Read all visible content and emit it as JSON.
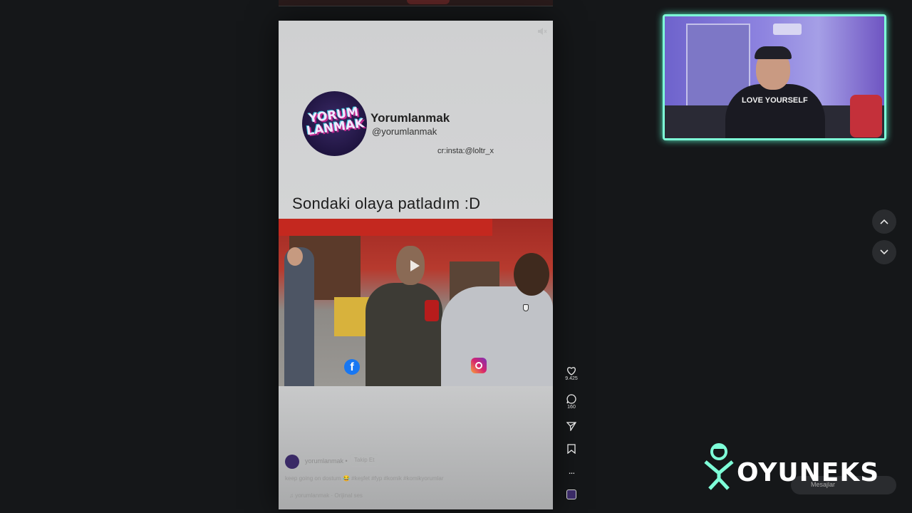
{
  "channel": {
    "name": "Yorumlanmak",
    "handle": "@yorumlanmak",
    "logo_text_line1": "YORUM",
    "logo_text_line2": "LANMAK",
    "credit": "cr:insta:@loltr_x"
  },
  "reel": {
    "caption_title": "Sondaki olaya patladım :D"
  },
  "post": {
    "username": "yorumlanmak",
    "separator": "•",
    "follow_label": "Takip Et",
    "caption": "keep going on dostum 😂 #keşfet #fyp #komik #komikyorumlar",
    "audio": "yorumlanmak · Orijinal ses"
  },
  "actions": {
    "likes": "9.425",
    "comments": "160",
    "more": "..."
  },
  "webcam": {
    "shirt_text": "LOVE YOURSELF"
  },
  "watermark": {
    "brand": "OYUNEKS"
  },
  "dock": {
    "messages_label": "Mesajlar"
  },
  "colors": {
    "background": "#151719",
    "webcam_border": "#7effd8",
    "brand_green": "#7effd8"
  }
}
